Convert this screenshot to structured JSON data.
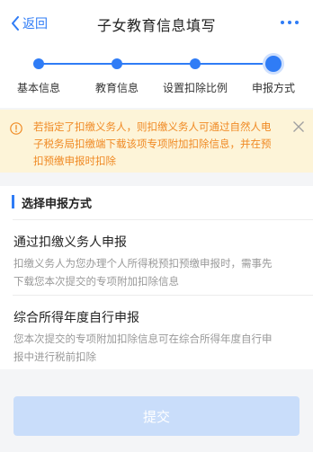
{
  "header": {
    "back_label": "返回",
    "title": "子女教育信息填写"
  },
  "steps": [
    {
      "label": "基本信息",
      "state": "done"
    },
    {
      "label": "教育信息",
      "state": "done"
    },
    {
      "label": "设置扣除比例",
      "state": "done"
    },
    {
      "label": "申报方式",
      "state": "current"
    }
  ],
  "notice": {
    "text": "若指定了扣缴义务人，则扣缴义务人可通过自然人电子税务局扣缴端下载该项专项附加扣除信息，并在预扣预缴申报时扣除",
    "color": "#f08a24",
    "background": "#fdf4d8"
  },
  "section": {
    "title": "选择申报方式",
    "options": [
      {
        "title": "通过扣缴义务人申报",
        "desc": "扣缴义务人为您办理个人所得税预扣预缴申报时，需事先下载您本次提交的专项附加扣除信息"
      },
      {
        "title": "综合所得年度自行申报",
        "desc": "您本次提交的专项附加扣除信息可在综合所得年度自行申报中进行税前扣除"
      }
    ]
  },
  "submit": {
    "label": "提交",
    "state": "disabled"
  },
  "colors": {
    "accent": "#2f7cf6",
    "submit_disabled": "#c9ddfa"
  }
}
